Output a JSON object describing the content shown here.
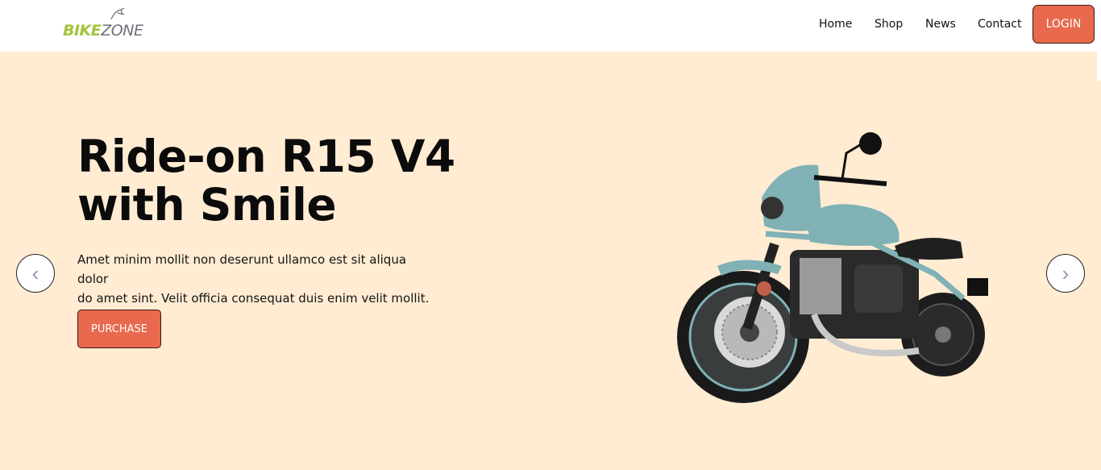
{
  "brand": {
    "part1": "BIKE",
    "part2": "ZONE"
  },
  "nav": {
    "home": "Home",
    "shop": "Shop",
    "news": "News",
    "contact": "Contact",
    "login": "LOGIN"
  },
  "hero": {
    "title_line1": "Ride-on R15 V4",
    "title_line2": "with Smile",
    "description_line1": "Amet minim mollit non deserunt ullamco est sit aliqua dolor",
    "description_line2": "do amet sint. Velit officia consequat duis enim velit mollit.",
    "cta": "PURCHASE"
  },
  "carousel": {
    "prev": "‹",
    "next": "›"
  },
  "colors": {
    "accent": "#e8694d",
    "background": "#ffecd3",
    "brand_green": "#a3c43c",
    "bike_body": "#7fb1b5"
  }
}
